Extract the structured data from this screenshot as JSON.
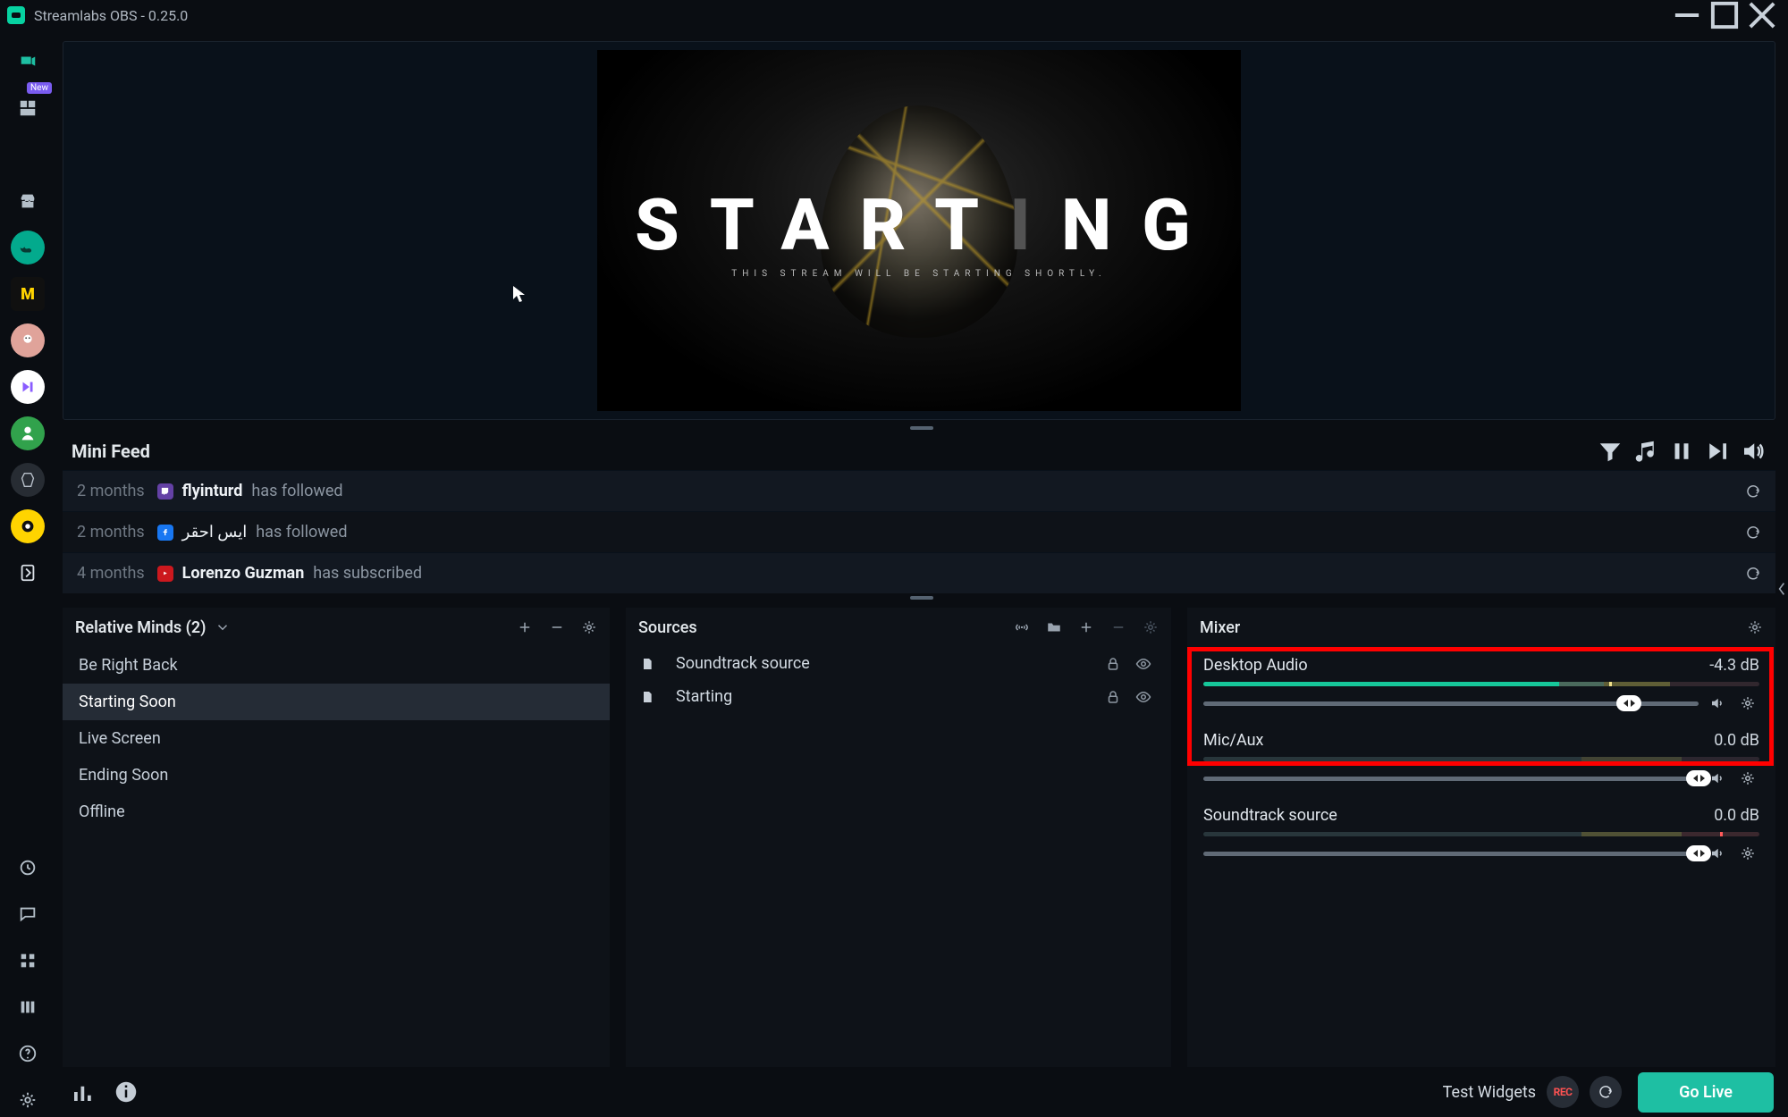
{
  "window": {
    "title": "Streamlabs OBS - 0.25.0"
  },
  "scene_preview": {
    "word_part1": "START",
    "word_part2": "I",
    "word_part3": "NG",
    "subtitle": "THIS STREAM WILL BE STARTING SHORTLY."
  },
  "mini_feed": {
    "title": "Mini Feed",
    "items": [
      {
        "time": "2 months",
        "platform": "tw",
        "user": "flyinturd",
        "action": "has followed"
      },
      {
        "time": "2 months",
        "platform": "fb",
        "user": "ايس احقر",
        "action": "has followed"
      },
      {
        "time": "4 months",
        "platform": "yt",
        "user": "Lorenzo Guzman",
        "action": "has subscribed"
      }
    ]
  },
  "scenes_panel": {
    "collection": "Relative Minds (2)",
    "items": [
      "Be Right Back",
      "Starting Soon",
      "Live Screen",
      "Ending Soon",
      "Offline"
    ],
    "active_index": 1
  },
  "sources_panel": {
    "title": "Sources",
    "items": [
      "Soundtrack source",
      "Starting"
    ]
  },
  "mixer_panel": {
    "title": "Mixer",
    "channels": [
      {
        "name": "Desktop Audio",
        "db": "-4.3 dB",
        "level_pct": 64,
        "tail_pct": 8,
        "peak_pct": 74,
        "slider_pct": 86
      },
      {
        "name": "Mic/Aux",
        "db": "0.0 dB",
        "level_pct": 0,
        "tail_pct": 0,
        "peak_pct": 0,
        "slider_pct": 100
      },
      {
        "name": "Soundtrack source",
        "db": "0.0 dB",
        "level_pct": 0,
        "tail_pct": 0,
        "peak_pct": 93,
        "slider_pct": 100
      }
    ]
  },
  "footer": {
    "test_widgets": "Test Widgets",
    "rec": "REC",
    "go_live": "Go Live"
  },
  "sidebar": {
    "new_badge": "New"
  }
}
